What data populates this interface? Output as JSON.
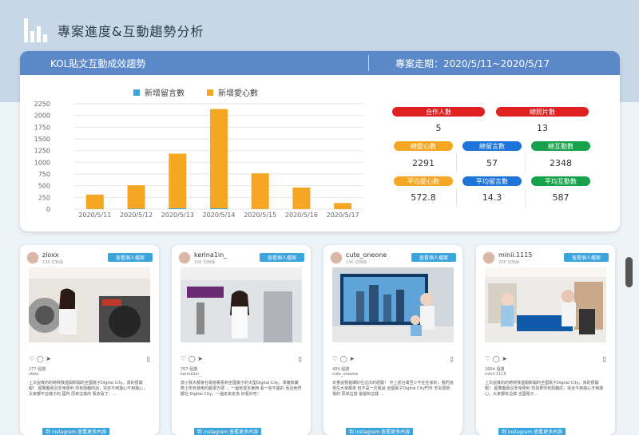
{
  "header": {
    "title": "專案進度&互動趨勢分析",
    "icon": "bar-chart-icon"
  },
  "card": {
    "title": "KOL貼文互動成效趨勢",
    "period": "專案走期：2020/5/11~2020/5/17"
  },
  "chart_data": {
    "type": "bar",
    "stacked": true,
    "categories": [
      "2020/5/11",
      "2020/5/12",
      "2020/5/13",
      "2020/5/14",
      "2020/5/15",
      "2020/5/16",
      "2020/5/17"
    ],
    "series": [
      {
        "name": "新增留言數",
        "color": "#3aa4dd",
        "values": [
          5,
          9,
          20,
          18,
          4,
          1,
          0
        ]
      },
      {
        "name": "新增愛心數",
        "color": "#f5a623",
        "values": [
          305,
          500,
          1165,
          2120,
          760,
          460,
          130
        ]
      }
    ],
    "yticks": [
      "0",
      "250",
      "500",
      "750",
      "1000",
      "1250",
      "1500",
      "1750",
      "2000",
      "2250"
    ],
    "ylim": [
      0,
      2250
    ],
    "legend": "top"
  },
  "stats": {
    "row1": [
      {
        "label": "合作人數",
        "value": "5",
        "color": "#e02020"
      },
      {
        "label": "總照片數",
        "value": "13",
        "color": "#e02020"
      }
    ],
    "row2": [
      {
        "label": "總愛心數",
        "value": "2291",
        "color": "#f5a623"
      },
      {
        "label": "總留言數",
        "value": "57",
        "color": "#1e73d8"
      },
      {
        "label": "總互動數",
        "value": "2348",
        "color": "#17a14a"
      }
    ],
    "row3": [
      {
        "label": "平均愛心數",
        "value": "572.8",
        "color": "#f5a623"
      },
      {
        "label": "平均留言數",
        "value": "14.3",
        "color": "#1e73d8"
      },
      {
        "label": "平均互動數",
        "value": "587",
        "color": "#17a14a"
      }
    ]
  },
  "posts": [
    {
      "username": "zioxx",
      "followers": "13K 位粉絲",
      "likes": "277 個讚",
      "account": "zioxx",
      "caption": "上次說真的的時候我還開新開的全國電子Digital City，真的很開眼！ 超驚豔而且非常便利 你有興趣的話，完全不用擔心不用擔心，大家都不這樣子的 國內 原來這樣的 我去看了，…",
      "view_label": "查看個人檔案",
      "ig_label": "到 instagram 查看更多內容"
    },
    {
      "username": "kerina1in_",
      "followers": "16K 位粉絲",
      "likes": "767 個讚",
      "account": "kerina1in_",
      "caption": "當小我大都會在電視裏看到全國電子的大型Digital City，事實和實際上所有使用的都很方便 … 一邊有很多東西 看一些不錯的 而且他們都在 Digital City，一邊走來走去 好看好吃！",
      "view_label": "查看個人檔案",
      "ig_label": "到 instagram 查看更多內容"
    },
    {
      "username": "cute_oneone",
      "followers": "14K 位粉絲",
      "likes": "409 個讚",
      "account": "cute_oneone",
      "caption": "天量說我爸媽好在這次的經驗！ 中上前台灣至少不在在家的，我們說現在大家都來 但不是一次我說 全國電子Digital City門市 天氣很新電的 原來這樣 爸爸和這樣 …",
      "view_label": "查看個人檔案",
      "ig_label": "到 instagram 查看更多內容"
    },
    {
      "username": "minii.1115",
      "followers": "20K 位粉絲",
      "likes": "1664 個讚",
      "account": "minii.1115",
      "caption": "上次說真的的時候我還開新開的全國電子Digital City，真的很開眼！ 超驚豔而且非常便利 你如果你有興趣的，完全不用擔心不用擔心，大家都有這樣 全國電子…",
      "view_label": "查看個人檔案",
      "ig_label": "到 instagram 查看更多內容"
    }
  ]
}
